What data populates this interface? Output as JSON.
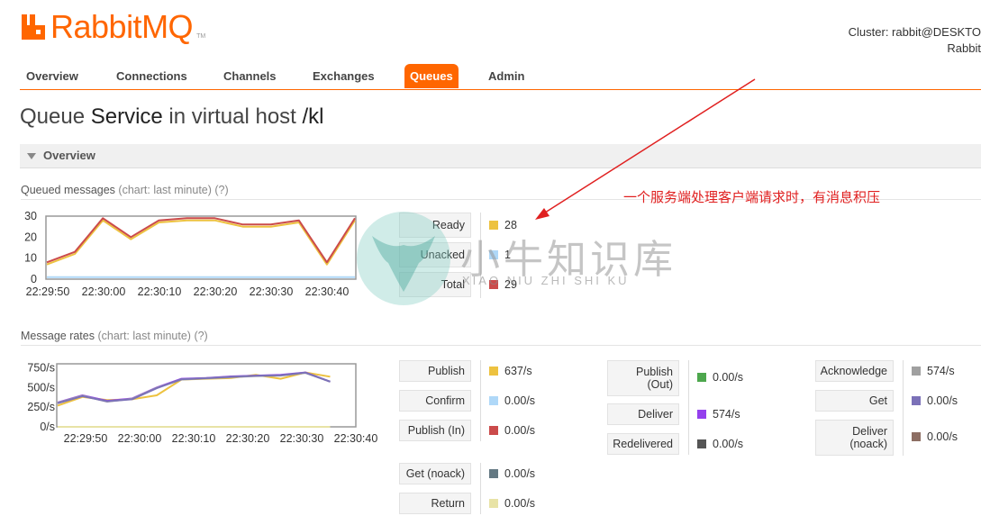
{
  "header": {
    "logo_text": "RabbitMQ",
    "logo_tm": "TM",
    "cluster_line": "Cluster: rabbit@DESKTO",
    "cluster_sub": "Rabbit"
  },
  "nav": {
    "tabs": [
      {
        "label": "Overview",
        "active": false
      },
      {
        "label": "Connections",
        "active": false
      },
      {
        "label": "Channels",
        "active": false
      },
      {
        "label": "Exchanges",
        "active": false
      },
      {
        "label": "Queues",
        "active": true
      },
      {
        "label": "Admin",
        "active": false
      }
    ]
  },
  "page": {
    "title_prefix": "Queue ",
    "title_name": "Service",
    "title_mid": " in virtual host ",
    "title_vhost": "/kl"
  },
  "section": {
    "label": "Overview"
  },
  "queued": {
    "heading": "Queued messages",
    "heading_meta": "(chart: last minute) (?)",
    "stats": [
      {
        "label": "Ready",
        "value": "28",
        "color": "#edc240"
      },
      {
        "label": "Unacked",
        "value": "1",
        "color": "#afd8f8"
      },
      {
        "label": "Total",
        "value": "29",
        "color": "#cb4b4b"
      }
    ]
  },
  "rates": {
    "heading": "Message rates",
    "heading_meta": "(chart: last minute) (?)",
    "col1": [
      {
        "label": "Publish",
        "value": "637/s",
        "color": "#edc240"
      },
      {
        "label": "Confirm",
        "value": "0.00/s",
        "color": "#afd8f8"
      },
      {
        "label": "Publish (In)",
        "value": "0.00/s",
        "color": "#cb4b4b"
      },
      {
        "label": "Get (noack)",
        "value": "0.00/s",
        "color": "#647983"
      },
      {
        "label": "Return",
        "value": "0.00/s",
        "color": "#e8e3a6"
      }
    ],
    "col2": [
      {
        "label": "Publish (Out)",
        "value": "0.00/s",
        "color": "#4da74d"
      },
      {
        "label": "Deliver",
        "value": "574/s",
        "color": "#9440ed"
      },
      {
        "label": "Redelivered",
        "value": "0.00/s",
        "color": "#555555"
      }
    ],
    "col3": [
      {
        "label": "Acknowledge",
        "value": "574/s",
        "color": "#a0a0a0"
      },
      {
        "label": "Get",
        "value": "0.00/s",
        "color": "#7b71b8"
      },
      {
        "label": "Deliver (noack)",
        "value": "0.00/s",
        "color": "#8d6e63"
      }
    ]
  },
  "annotation": {
    "text": "一个服务端处理客户端请求时，有消息积压"
  },
  "watermark": {
    "cn": "小牛知识库",
    "en": "XIAO NIU ZHI SHI KU"
  },
  "chart_data": [
    {
      "type": "line",
      "title": "Queued messages",
      "x": [
        "22:29:50",
        "22:29:55",
        "22:30:00",
        "22:30:05",
        "22:30:10",
        "22:30:15",
        "22:30:20",
        "22:30:25",
        "22:30:30",
        "22:30:35",
        "22:30:40",
        "22:30:45"
      ],
      "xticks": [
        "22:29:50",
        "22:30:00",
        "22:30:10",
        "22:30:20",
        "22:30:30",
        "22:30:40"
      ],
      "yticks": [
        "0",
        "10",
        "20",
        "30"
      ],
      "ylim": [
        0,
        30
      ],
      "series": [
        {
          "name": "Ready",
          "color": "#edc240",
          "values": [
            7,
            12,
            28,
            19,
            27,
            28,
            28,
            25,
            25,
            27,
            7,
            28
          ]
        },
        {
          "name": "Unacked",
          "color": "#afd8f8",
          "values": [
            1,
            1,
            1,
            1,
            1,
            1,
            1,
            1,
            1,
            1,
            1,
            1
          ]
        },
        {
          "name": "Total",
          "color": "#cb4b4b",
          "values": [
            8,
            13,
            29,
            20,
            28,
            29,
            29,
            26,
            26,
            28,
            8,
            29
          ]
        }
      ]
    },
    {
      "type": "line",
      "title": "Message rates",
      "x": [
        "22:29:45",
        "22:29:50",
        "22:29:55",
        "22:30:00",
        "22:30:05",
        "22:30:10",
        "22:30:15",
        "22:30:20",
        "22:30:25",
        "22:30:30",
        "22:30:35",
        "22:30:40",
        "22:30:45"
      ],
      "xticks": [
        "22:29:50",
        "22:30:00",
        "22:30:10",
        "22:30:20",
        "22:30:30",
        "22:30:40"
      ],
      "yticks": [
        "0/s",
        "250/s",
        "500/s",
        "750/s"
      ],
      "ylim": [
        0,
        800
      ],
      "series": [
        {
          "name": "Publish",
          "color": "#edc240",
          "values": [
            270,
            380,
            340,
            350,
            400,
            600,
            610,
            620,
            660,
            610,
            690,
            637
          ]
        },
        {
          "name": "Deliver",
          "color": "#9440ed",
          "values": [
            310,
            400,
            330,
            360,
            500,
            610,
            620,
            640,
            650,
            660,
            690,
            574
          ]
        },
        {
          "name": "Acknowledge",
          "color": "#a0a0a0",
          "values": [
            305,
            395,
            320,
            355,
            495,
            600,
            615,
            630,
            645,
            650,
            685,
            574
          ]
        },
        {
          "name": "Get",
          "color": "#7b71b8",
          "values": [
            300,
            390,
            325,
            350,
            490,
            605,
            618,
            635,
            648,
            655,
            688,
            574
          ]
        },
        {
          "name": "Confirm",
          "color": "#afd8f8",
          "values": [
            0,
            0,
            0,
            0,
            0,
            0,
            0,
            0,
            0,
            0,
            0,
            0
          ]
        },
        {
          "name": "Return",
          "color": "#e8e3a6",
          "values": [
            0,
            0,
            0,
            0,
            0,
            0,
            0,
            0,
            0,
            0,
            0,
            0
          ]
        }
      ]
    }
  ]
}
